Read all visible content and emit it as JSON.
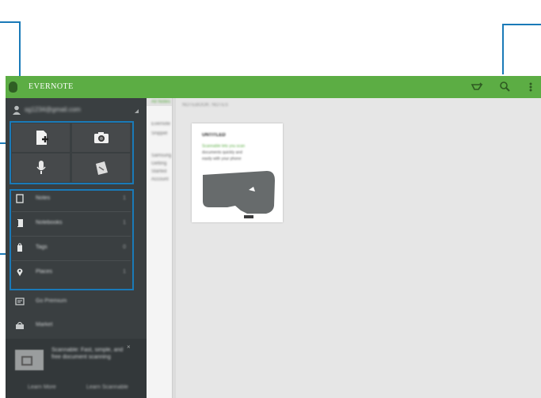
{
  "app": {
    "title": "EVERNOTE"
  },
  "appbar": {
    "icons": [
      "work-chat-icon",
      "search-icon",
      "more-options-icon"
    ]
  },
  "account": {
    "email": "sg1234@gmail.com"
  },
  "quick_actions": [
    {
      "name": "new-note",
      "icon": "new-note-icon"
    },
    {
      "name": "camera",
      "icon": "camera-icon"
    },
    {
      "name": "audio",
      "icon": "microphone-icon"
    },
    {
      "name": "handwriting",
      "icon": "handwriting-icon"
    }
  ],
  "nav": {
    "items": [
      {
        "label": "Notes",
        "count": "1",
        "icon": "notes-icon"
      },
      {
        "label": "Notebooks",
        "count": "1",
        "icon": "notebooks-icon"
      },
      {
        "label": "Tags",
        "count": "0",
        "icon": "tags-icon"
      },
      {
        "label": "Places",
        "count": "1",
        "icon": "places-icon"
      }
    ],
    "extra": [
      {
        "label": "Go Premium",
        "icon": "premium-icon"
      },
      {
        "label": "Market",
        "icon": "market-icon"
      }
    ]
  },
  "promo": {
    "text": "Scannable: Fast, simple, and free document scanning",
    "close": "×",
    "buttons": [
      "Learn More",
      "Learn Scannable"
    ]
  },
  "notelist": {
    "header": "All Notes",
    "items": [
      "Evernote",
      "Snippet",
      "Samsung",
      "Getting",
      "Started",
      "Account"
    ]
  },
  "content": {
    "header": "NOTEBOOK: NOTES",
    "note": {
      "title": "UNTITLED",
      "lines": [
        "Scannable lets you scan",
        "documents quickly and",
        "easily with your phone"
      ]
    }
  },
  "colors": {
    "appbar": "#5cad44",
    "sidebar": "#3a3f41",
    "callout": "#1a7ab8"
  }
}
